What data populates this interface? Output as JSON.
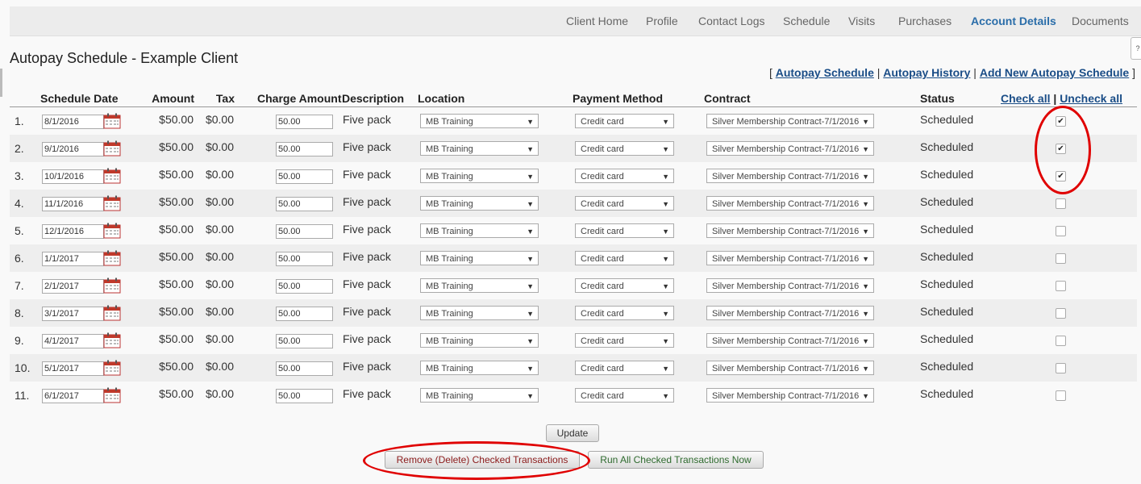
{
  "nav": {
    "tabs": [
      {
        "label": "Client Home",
        "active": false
      },
      {
        "label": "Profile",
        "active": false
      },
      {
        "label": "Contact Logs",
        "active": false
      },
      {
        "label": "Schedule",
        "active": false
      },
      {
        "label": "Visits",
        "active": false
      },
      {
        "label": "Purchases",
        "active": false
      },
      {
        "label": "Account Details",
        "active": true
      },
      {
        "label": "Documents",
        "active": false
      }
    ],
    "help_label": "?"
  },
  "page": {
    "title": "Autopay Schedule - Example Client"
  },
  "sublinks": {
    "open": "[",
    "autopay_schedule": "Autopay Schedule",
    "sep1": "|",
    "autopay_history": "Autopay History",
    "sep2": "|",
    "add_new": "Add New Autopay Schedule",
    "close": "]"
  },
  "table": {
    "headers": {
      "schedule_date": "Schedule Date",
      "amount": "Amount",
      "tax": "Tax",
      "charge_amount": "Charge Amount",
      "description": "Description",
      "location": "Location",
      "payment_method": "Payment Method",
      "contract": "Contract",
      "status": "Status",
      "check_all": "Check all",
      "sep": "|",
      "uncheck_all": "Uncheck all"
    },
    "rows": [
      {
        "num": "1.",
        "date": "8/1/2016",
        "amount": "$50.00",
        "tax": "$0.00",
        "charge": "50.00",
        "description": "Five pack",
        "location": "MB Training",
        "payment": "Credit card",
        "contract": "Silver Membership Contract-7/1/2016",
        "status": "Scheduled",
        "checked": true
      },
      {
        "num": "2.",
        "date": "9/1/2016",
        "amount": "$50.00",
        "tax": "$0.00",
        "charge": "50.00",
        "description": "Five pack",
        "location": "MB Training",
        "payment": "Credit card",
        "contract": "Silver Membership Contract-7/1/2016",
        "status": "Scheduled",
        "checked": true
      },
      {
        "num": "3.",
        "date": "10/1/2016",
        "amount": "$50.00",
        "tax": "$0.00",
        "charge": "50.00",
        "description": "Five pack",
        "location": "MB Training",
        "payment": "Credit card",
        "contract": "Silver Membership Contract-7/1/2016",
        "status": "Scheduled",
        "checked": true
      },
      {
        "num": "4.",
        "date": "11/1/2016",
        "amount": "$50.00",
        "tax": "$0.00",
        "charge": "50.00",
        "description": "Five pack",
        "location": "MB Training",
        "payment": "Credit card",
        "contract": "Silver Membership Contract-7/1/2016",
        "status": "Scheduled",
        "checked": false
      },
      {
        "num": "5.",
        "date": "12/1/2016",
        "amount": "$50.00",
        "tax": "$0.00",
        "charge": "50.00",
        "description": "Five pack",
        "location": "MB Training",
        "payment": "Credit card",
        "contract": "Silver Membership Contract-7/1/2016",
        "status": "Scheduled",
        "checked": false
      },
      {
        "num": "6.",
        "date": "1/1/2017",
        "amount": "$50.00",
        "tax": "$0.00",
        "charge": "50.00",
        "description": "Five pack",
        "location": "MB Training",
        "payment": "Credit card",
        "contract": "Silver Membership Contract-7/1/2016",
        "status": "Scheduled",
        "checked": false
      },
      {
        "num": "7.",
        "date": "2/1/2017",
        "amount": "$50.00",
        "tax": "$0.00",
        "charge": "50.00",
        "description": "Five pack",
        "location": "MB Training",
        "payment": "Credit card",
        "contract": "Silver Membership Contract-7/1/2016",
        "status": "Scheduled",
        "checked": false
      },
      {
        "num": "8.",
        "date": "3/1/2017",
        "amount": "$50.00",
        "tax": "$0.00",
        "charge": "50.00",
        "description": "Five pack",
        "location": "MB Training",
        "payment": "Credit card",
        "contract": "Silver Membership Contract-7/1/2016",
        "status": "Scheduled",
        "checked": false
      },
      {
        "num": "9.",
        "date": "4/1/2017",
        "amount": "$50.00",
        "tax": "$0.00",
        "charge": "50.00",
        "description": "Five pack",
        "location": "MB Training",
        "payment": "Credit card",
        "contract": "Silver Membership Contract-7/1/2016",
        "status": "Scheduled",
        "checked": false
      },
      {
        "num": "10.",
        "date": "5/1/2017",
        "amount": "$50.00",
        "tax": "$0.00",
        "charge": "50.00",
        "description": "Five pack",
        "location": "MB Training",
        "payment": "Credit card",
        "contract": "Silver Membership Contract-7/1/2016",
        "status": "Scheduled",
        "checked": false
      },
      {
        "num": "11.",
        "date": "6/1/2017",
        "amount": "$50.00",
        "tax": "$0.00",
        "charge": "50.00",
        "description": "Five pack",
        "location": "MB Training",
        "payment": "Credit card",
        "contract": "Silver Membership Contract-7/1/2016",
        "status": "Scheduled",
        "checked": false
      }
    ]
  },
  "actions": {
    "update": "Update",
    "remove": "Remove (Delete) Checked Transactions",
    "run": "Run All Checked Transactions Now"
  },
  "icons": {
    "calendar": "calendar-icon",
    "dropdown": "chevron-down-icon",
    "check": "checkmark-icon"
  },
  "colors": {
    "link": "#1a4d87",
    "active_tab": "#2a6da9",
    "highlight_ring": "#e00000",
    "remove_text": "#8b1a1a",
    "run_text": "#2f6b2f"
  }
}
